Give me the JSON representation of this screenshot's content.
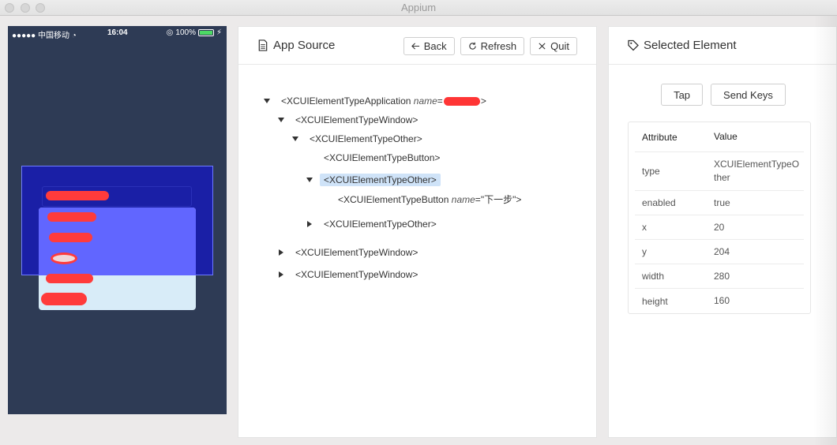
{
  "window": {
    "title": "Appium"
  },
  "device": {
    "status": {
      "carrier": "●●●●● 中国移动",
      "time": "16:04",
      "battery": "100%"
    }
  },
  "source_panel": {
    "title": "App Source",
    "buttons": {
      "back": "Back",
      "refresh": "Refresh",
      "quit": "Quit"
    },
    "tree": [
      {
        "tag": "<XCUIElementTypeApplication",
        "attr": "name",
        "value_redacted": true,
        "close": ">",
        "expanded": true,
        "selected": false
      },
      {
        "tag": "<XCUIElementTypeWindow>",
        "expanded": true,
        "selected": false
      },
      {
        "tag": "<XCUIElementTypeOther>",
        "expanded": true,
        "selected": false
      },
      {
        "tag": "<XCUIElementTypeButton>",
        "leaf": true,
        "selected": false
      },
      {
        "tag": "<XCUIElementTypeOther>",
        "expanded": true,
        "selected": true
      },
      {
        "tag": "<XCUIElementTypeButton",
        "attr": "name",
        "value": "\"下一步\"",
        "close": ">",
        "leaf": true,
        "selected": false
      },
      {
        "tag": "<XCUIElementTypeOther>",
        "expanded": false,
        "selected": false
      },
      {
        "tag": "<XCUIElementTypeWindow>",
        "expanded": false,
        "selected": false
      },
      {
        "tag": "<XCUIElementTypeWindow>",
        "expanded": false,
        "selected": false
      }
    ]
  },
  "selected_panel": {
    "title": "Selected Element",
    "buttons": {
      "tap": "Tap",
      "send_keys": "Send Keys"
    },
    "table": {
      "headers": {
        "attribute": "Attribute",
        "value": "Value"
      },
      "rows": [
        {
          "attribute": "type",
          "value": "XCUIElementTypeOther"
        },
        {
          "attribute": "enabled",
          "value": "true"
        },
        {
          "attribute": "x",
          "value": "20"
        },
        {
          "attribute": "y",
          "value": "204"
        },
        {
          "attribute": "width",
          "value": "280"
        },
        {
          "attribute": "height",
          "value": "160"
        }
      ]
    }
  },
  "colors": {
    "selection": "#cfe3f8",
    "highlight": "#1a1fa6",
    "redaction": "#ff3535",
    "device_bg": "#2e3b55"
  }
}
